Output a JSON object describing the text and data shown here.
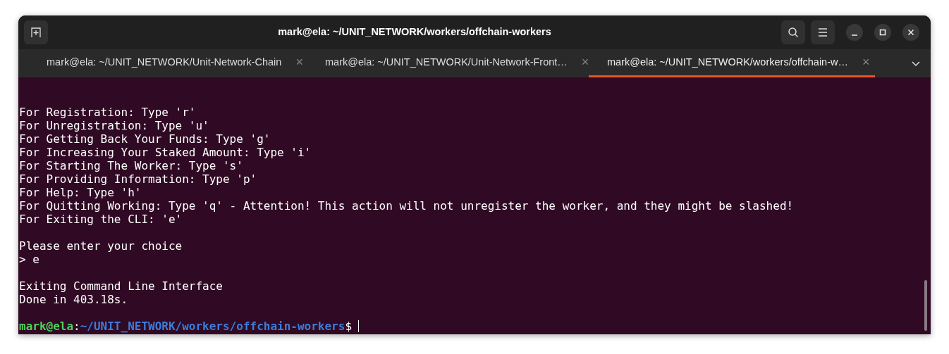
{
  "window": {
    "title": "mark@ela: ~/UNIT_NETWORK/workers/offchain-workers"
  },
  "tabs": [
    {
      "label": "mark@ela: ~/UNIT_NETWORK/Unit-Network-Chain",
      "close": "×",
      "selected": false
    },
    {
      "label": "mark@ela: ~/UNIT_NETWORK/Unit-Network-Front…",
      "close": "×",
      "selected": false
    },
    {
      "label": "mark@ela: ~/UNIT_NETWORK/workers/offchain-w…",
      "close": "×",
      "selected": true
    }
  ],
  "terminal": {
    "blocks": [
      [
        "For Registration: Type 'r'",
        "For Unregistration: Type 'u'",
        "For Getting Back Your Funds: Type 'g'",
        "For Increasing Your Staked Amount: Type 'i'",
        "For Starting The Worker: Type 's'",
        "For Providing Information: Type 'p'",
        "For Help: Type 'h'",
        "For Quitting Working: Type 'q' - Attention! This action will not unregister the worker, and they might be slashed!",
        "For Exiting the CLI: 'e'"
      ],
      [
        "Please enter your choice",
        "> e"
      ],
      [
        "Exiting Command Line Interface",
        "Done in 403.18s."
      ]
    ],
    "prompt": {
      "user": "mark@ela",
      "separator": ":",
      "path": "~/UNIT_NETWORK/workers/offchain-workers",
      "symbol": "$"
    }
  }
}
